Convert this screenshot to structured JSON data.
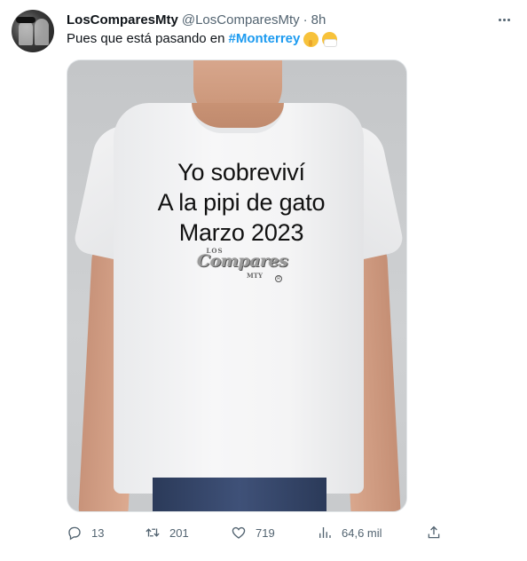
{
  "tweet": {
    "author_name": "LosComparesMty",
    "handle": "@LosComparesMty",
    "separator": "·",
    "time": "8h",
    "text_prefix": "Pues que está pasando en",
    "hashtag": "#Monterrey",
    "emojis": [
      "shushing-face",
      "face-with-medical-mask"
    ]
  },
  "media": {
    "shirt_line1": "Yo sobreviví",
    "shirt_line2": "A la pipi de gato",
    "shirt_line3": "Marzo 2023",
    "logo_top": "LOS",
    "logo_main": "Compares",
    "logo_bottom": "MTY",
    "logo_mark": "R"
  },
  "actions": {
    "replies": "13",
    "retweets": "201",
    "likes": "719",
    "views": "64,6 mil"
  },
  "icons": {
    "reply": "reply-icon",
    "retweet": "retweet-icon",
    "like": "heart-icon",
    "views": "views-icon",
    "share": "share-icon",
    "more": "more-icon"
  },
  "colors": {
    "hashtag": "#1d9bf0",
    "secondary_text": "#536471",
    "primary_text": "#0f1419"
  }
}
